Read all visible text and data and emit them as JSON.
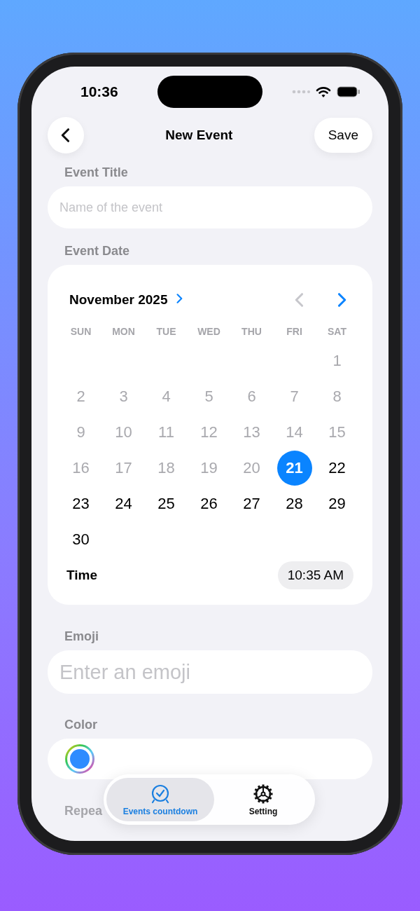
{
  "status_bar": {
    "time": "10:36"
  },
  "nav": {
    "title": "New Event",
    "save": "Save"
  },
  "event_title": {
    "label": "Event Title",
    "placeholder": "Name of the event"
  },
  "event_date": {
    "label": "Event Date",
    "month": "November 2025",
    "weekdays": [
      "SUN",
      "MON",
      "TUE",
      "WED",
      "THU",
      "FRI",
      "SAT"
    ],
    "weeks": [
      [
        {
          "label": "1",
          "disabled": true,
          "selected": false
        }
      ],
      [
        {
          "label": "2",
          "disabled": true,
          "selected": false
        },
        {
          "label": "3",
          "disabled": true,
          "selected": false
        },
        {
          "label": "4",
          "disabled": true,
          "selected": false
        },
        {
          "label": "5",
          "disabled": true,
          "selected": false
        },
        {
          "label": "6",
          "disabled": true,
          "selected": false
        },
        {
          "label": "7",
          "disabled": true,
          "selected": false
        },
        {
          "label": "8",
          "disabled": true,
          "selected": false
        }
      ],
      [
        {
          "label": "9",
          "disabled": true,
          "selected": false
        },
        {
          "label": "10",
          "disabled": true,
          "selected": false
        },
        {
          "label": "11",
          "disabled": true,
          "selected": false
        },
        {
          "label": "12",
          "disabled": true,
          "selected": false
        },
        {
          "label": "13",
          "disabled": true,
          "selected": false
        },
        {
          "label": "14",
          "disabled": true,
          "selected": false
        },
        {
          "label": "15",
          "disabled": true,
          "selected": false
        }
      ],
      [
        {
          "label": "16",
          "disabled": true,
          "selected": false
        },
        {
          "label": "17",
          "disabled": true,
          "selected": false
        },
        {
          "label": "18",
          "disabled": true,
          "selected": false
        },
        {
          "label": "19",
          "disabled": true,
          "selected": false
        },
        {
          "label": "20",
          "disabled": true,
          "selected": false
        },
        {
          "label": "21",
          "disabled": false,
          "selected": true
        },
        {
          "label": "22",
          "disabled": false,
          "selected": false
        }
      ],
      [
        {
          "label": "23",
          "disabled": false,
          "selected": false
        },
        {
          "label": "24",
          "disabled": false,
          "selected": false
        },
        {
          "label": "25",
          "disabled": false,
          "selected": false
        },
        {
          "label": "26",
          "disabled": false,
          "selected": false
        },
        {
          "label": "27",
          "disabled": false,
          "selected": false
        },
        {
          "label": "28",
          "disabled": false,
          "selected": false
        },
        {
          "label": "29",
          "disabled": false,
          "selected": false
        }
      ],
      [
        {
          "label": "30",
          "disabled": false,
          "selected": false
        }
      ]
    ],
    "prev_disabled": true,
    "time_label": "Time",
    "time_value": "10:35 AM"
  },
  "emoji": {
    "label": "Emoji",
    "placeholder": "Enter an emoji"
  },
  "color": {
    "label": "Color",
    "color": "#2f8cff"
  },
  "repeat": {
    "label": "Repea"
  },
  "tabs": [
    {
      "label": "Events countdown",
      "selected": true
    },
    {
      "label": "Setting",
      "selected": false
    }
  ]
}
